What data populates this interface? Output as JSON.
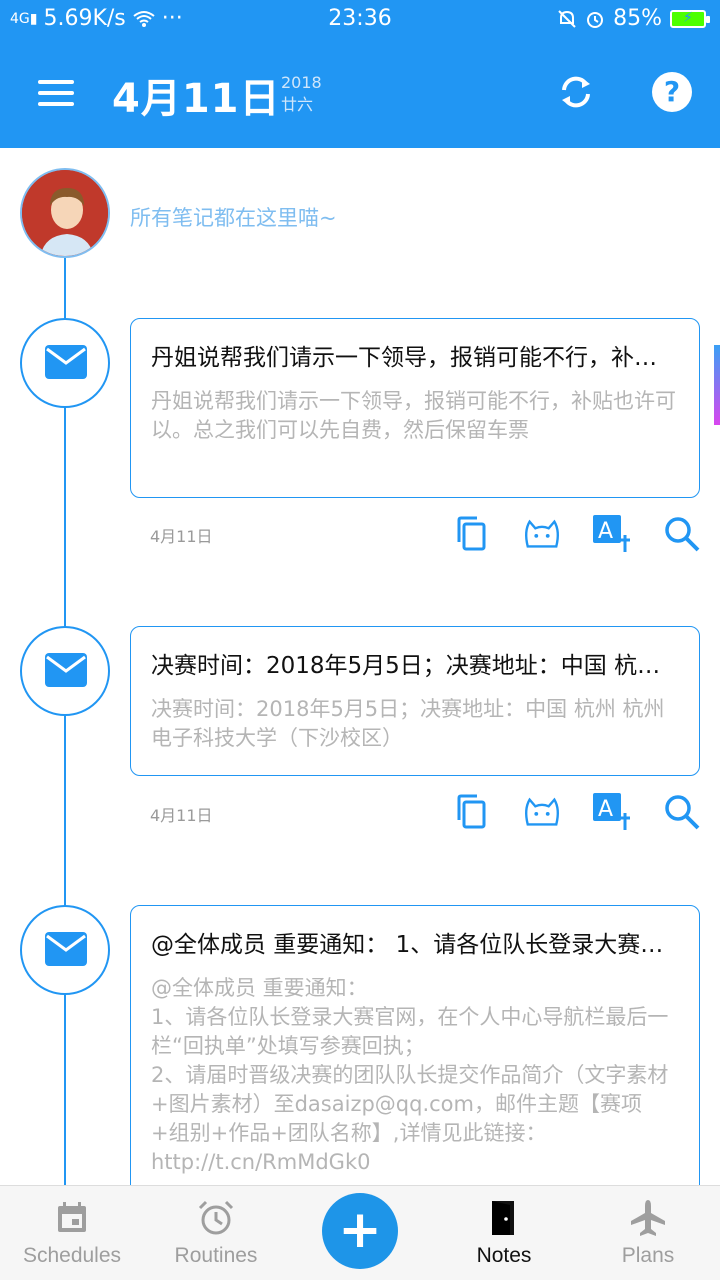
{
  "status": {
    "network": "4G",
    "speed": "5.69K/s",
    "dots": "···",
    "time": "23:36",
    "battery": "85%"
  },
  "header": {
    "date": "4月11日",
    "year": "2018",
    "lunar": "廿六"
  },
  "intro": {
    "message": "所有笔记都在这里喵~"
  },
  "notes": [
    {
      "title": "丹姐说帮我们请示一下领导，报销可能不行，补贴也许可以。总之我们可以先自费，然后保留车票",
      "body": "丹姐说帮我们请示一下领导，报销可能不行，补贴也许可以。总之我们可以先自费，然后保留车票",
      "date": "4月11日"
    },
    {
      "title": "决赛时间：2018年5月5日；决赛地址：中国 杭州 杭州电子科技大学（下沙校区）",
      "body": "决赛时间：2018年5月5日；决赛地址：中国 杭州 杭州电子科技大学（下沙校区）",
      "date": "4月11日"
    },
    {
      "title": "@全体成员 重要通知： 1、请各位队长登录大赛官网",
      "body": "@全体成员 重要通知：\n1、请各位队长登录大赛官网，在个人中心导航栏最后一栏“回执单”处填写参赛回执；\n2、请届时晋级决赛的团队队长提交作品简介（文字素材+图片素材）至dasaizp@qq.com，邮件主题【赛项+组别+作品+团队名称】,详情见此链接：http://t.cn/RmMdGk0"
    }
  ],
  "nav": {
    "schedules": "Schedules",
    "routines": "Routines",
    "add": "+",
    "notes": "Notes",
    "plans": "Plans"
  },
  "colors": {
    "primary": "#2196f3",
    "muted_text": "#b5b5b5",
    "greeting": "#7fbdf0"
  }
}
